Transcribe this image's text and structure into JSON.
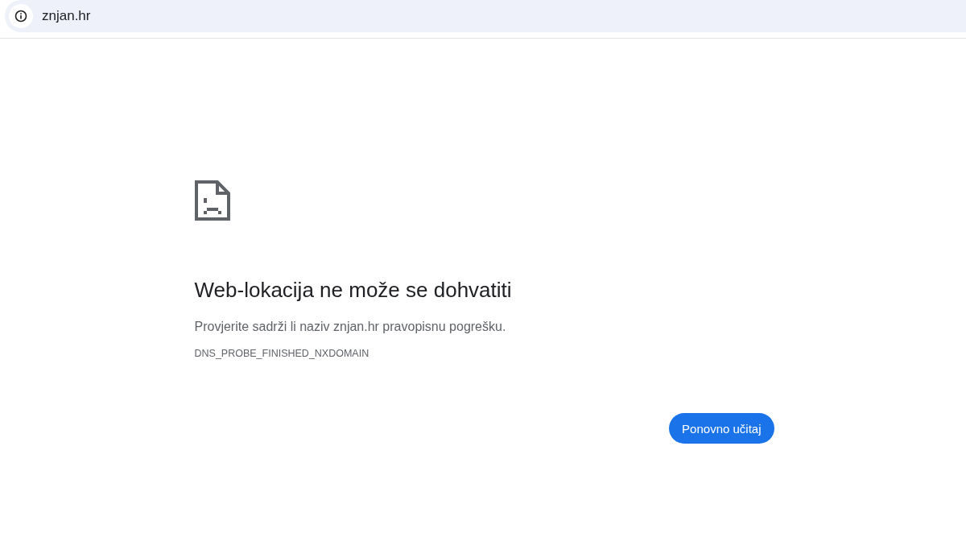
{
  "address_bar": {
    "url": "znjan.hr"
  },
  "error": {
    "title": "Web-lokacija ne može se dohvatiti",
    "message": "Provjerite sadrži li naziv znjan.hr pravopisnu pogrešku.",
    "code": "DNS_PROBE_FINISHED_NXDOMAIN"
  },
  "buttons": [
    {
      "label": "Ponovno učitaj"
    }
  ]
}
